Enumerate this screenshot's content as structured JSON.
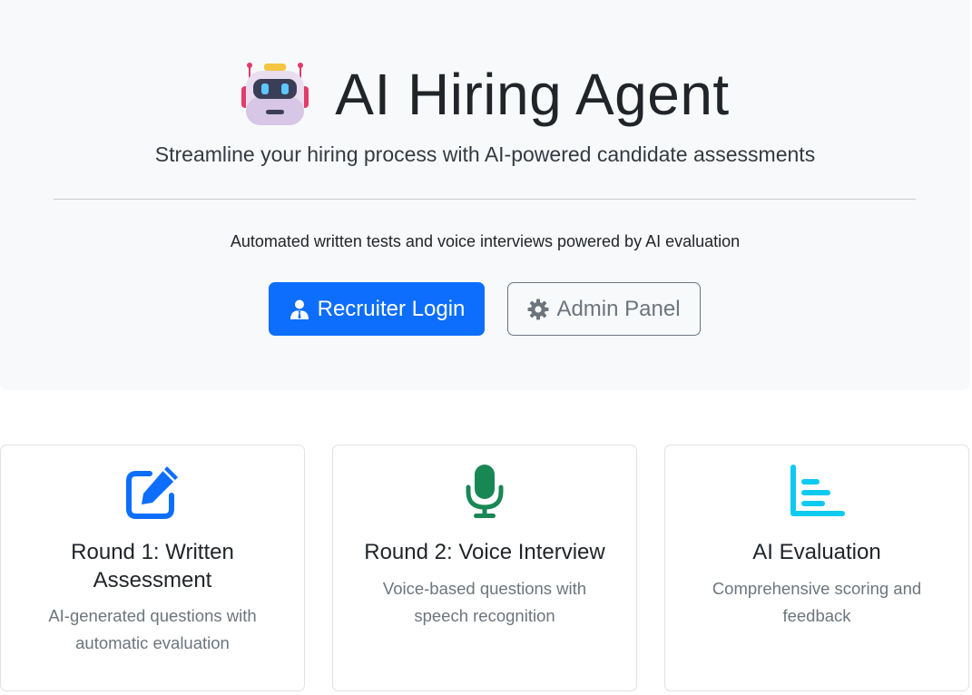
{
  "hero": {
    "icon": "robot-icon",
    "title": "AI Hiring Agent",
    "subtitle": "Streamline your hiring process with AI-powered candidate assessments",
    "tagline": "Automated written tests and voice interviews powered by AI evaluation",
    "primary_button": {
      "label": "Recruiter Login",
      "icon": "user-tie-icon",
      "color": "#0d6efd"
    },
    "secondary_button": {
      "label": "Admin Panel",
      "icon": "gear-icon",
      "color": "#6c757d"
    }
  },
  "features": [
    {
      "title": "Round 1: Written Assessment",
      "text": "AI-generated questions with automatic evaluation",
      "icon": "pen-to-square-icon",
      "color": "#0d6efd"
    },
    {
      "title": "Round 2: Voice Interview",
      "text": "Voice-based questions with speech recognition",
      "icon": "microphone-icon",
      "color": "#198754"
    },
    {
      "title": "AI Evaluation",
      "text": "Comprehensive scoring and feedback",
      "icon": "chart-bar-icon",
      "color": "#0dcaf0"
    }
  ]
}
